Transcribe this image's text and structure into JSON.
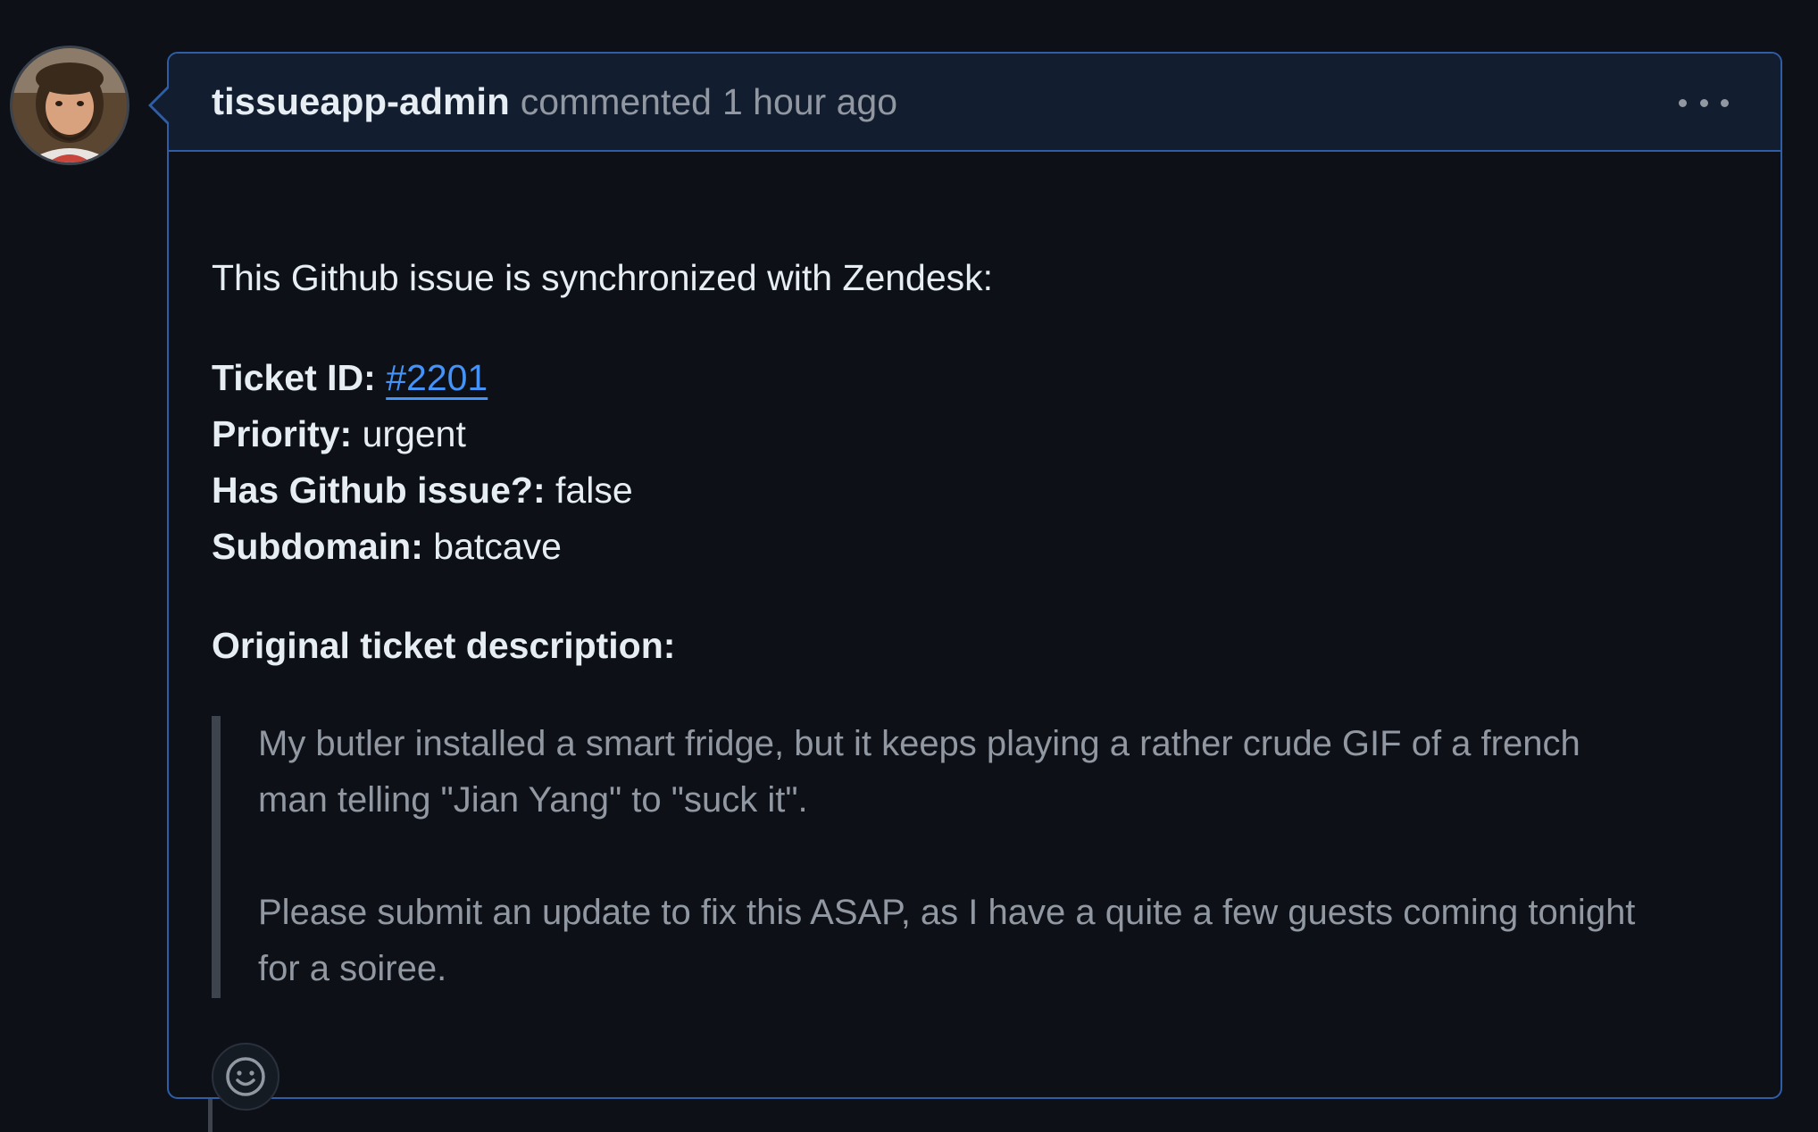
{
  "comment": {
    "author": "tissueapp-admin",
    "action": "commented",
    "timestamp": "1 hour ago",
    "intro": "This Github issue is synchronized with Zendesk:",
    "fields": [
      {
        "label": "Ticket ID:",
        "value": "#2201",
        "is_link": true
      },
      {
        "label": "Priority:",
        "value": "urgent"
      },
      {
        "label": "Has Github issue?:",
        "value": "false"
      },
      {
        "label": "Subdomain:",
        "value": "batcave"
      }
    ],
    "description_heading": "Original ticket description:",
    "description_paragraphs": [
      "My butler installed a smart fridge, but it keeps playing a rather crude GIF of a french man telling \"Jian Yang\" to \"suck it\".",
      "Please submit an update to fix this ASAP, as I have a quite a few guests coming tonight for a soiree."
    ]
  },
  "icons": {
    "avatar": "user-avatar",
    "more": "kebab-horizontal-icon",
    "reaction": "smiley-icon"
  },
  "colors": {
    "background": "#0d1117",
    "header_background": "#121d2f",
    "border_accent": "#2f5ea6",
    "link": "#4493f8",
    "muted_text": "#9198a1",
    "text": "#e6edf3"
  }
}
